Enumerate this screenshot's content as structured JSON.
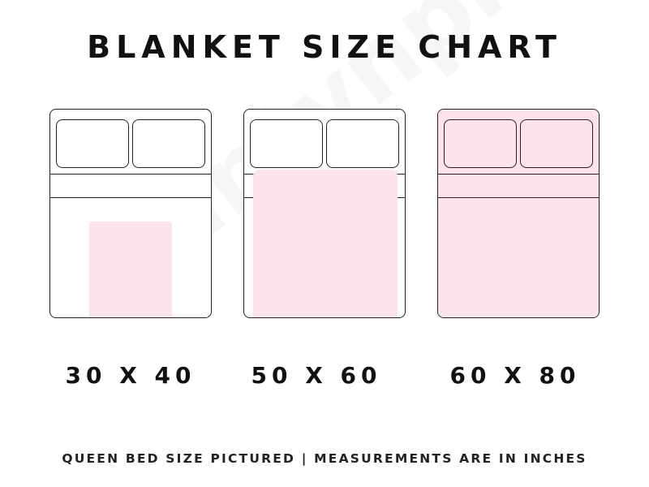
{
  "title": "BLANKET SIZE CHART",
  "watermark": "Printynpink",
  "sizes": [
    {
      "label": "30 X 40",
      "width_in": 30,
      "length_in": 40
    },
    {
      "label": "50 X 60",
      "width_in": 50,
      "length_in": 60
    },
    {
      "label": "60 X 80",
      "width_in": 60,
      "length_in": 80
    }
  ],
  "footer": "QUEEN BED SIZE PICTURED | MEASUREMENTS ARE IN INCHES",
  "colors": {
    "blanket": "#fde4ea",
    "outline": "#222222",
    "text": "#111111"
  }
}
